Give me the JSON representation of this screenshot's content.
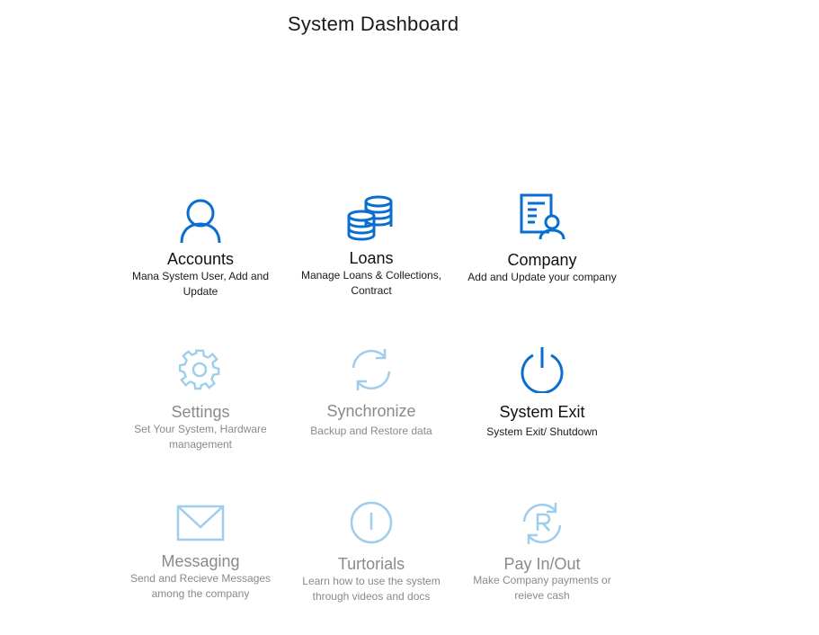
{
  "header": {
    "title": "System Dashboard"
  },
  "colors": {
    "icon_active": "#0a6ed1",
    "icon_disabled": "#9fcdec",
    "text_active": "#111111",
    "text_disabled": "#8a8a8a"
  },
  "tiles": [
    {
      "id": "accounts",
      "icon": "user-icon",
      "label": "Accounts",
      "desc": "Mana System User, Add and Update",
      "enabled": true
    },
    {
      "id": "loans",
      "icon": "coins-icon",
      "label": "Loans",
      "desc": "Manage Loans & Collections, Contract",
      "enabled": true
    },
    {
      "id": "company",
      "icon": "company-document-icon",
      "label": "Company",
      "desc": "Add and Update your company",
      "enabled": true
    },
    {
      "id": "settings",
      "icon": "gear-icon",
      "label": "Settings",
      "desc": "Set Your System, Hardware management",
      "enabled": false
    },
    {
      "id": "synchronize",
      "icon": "sync-icon",
      "label": "Synchronize",
      "desc": "Backup and Restore data",
      "enabled": false
    },
    {
      "id": "system-exit",
      "icon": "power-icon",
      "label": "System Exit",
      "desc": "System Exit/ Shutdown",
      "enabled": true
    },
    {
      "id": "messaging",
      "icon": "envelope-icon",
      "label": "Messaging",
      "desc": "Send and Recieve Messages among the company",
      "enabled": false
    },
    {
      "id": "tutorials",
      "icon": "info-icon",
      "label": "Turtorials",
      "desc": "Learn how to use the system through videos and docs",
      "enabled": false
    },
    {
      "id": "pay-in-out",
      "icon": "currency-refresh-icon",
      "label": "Pay In/Out",
      "desc": "Make Company payments or reieve cash",
      "enabled": false
    }
  ]
}
